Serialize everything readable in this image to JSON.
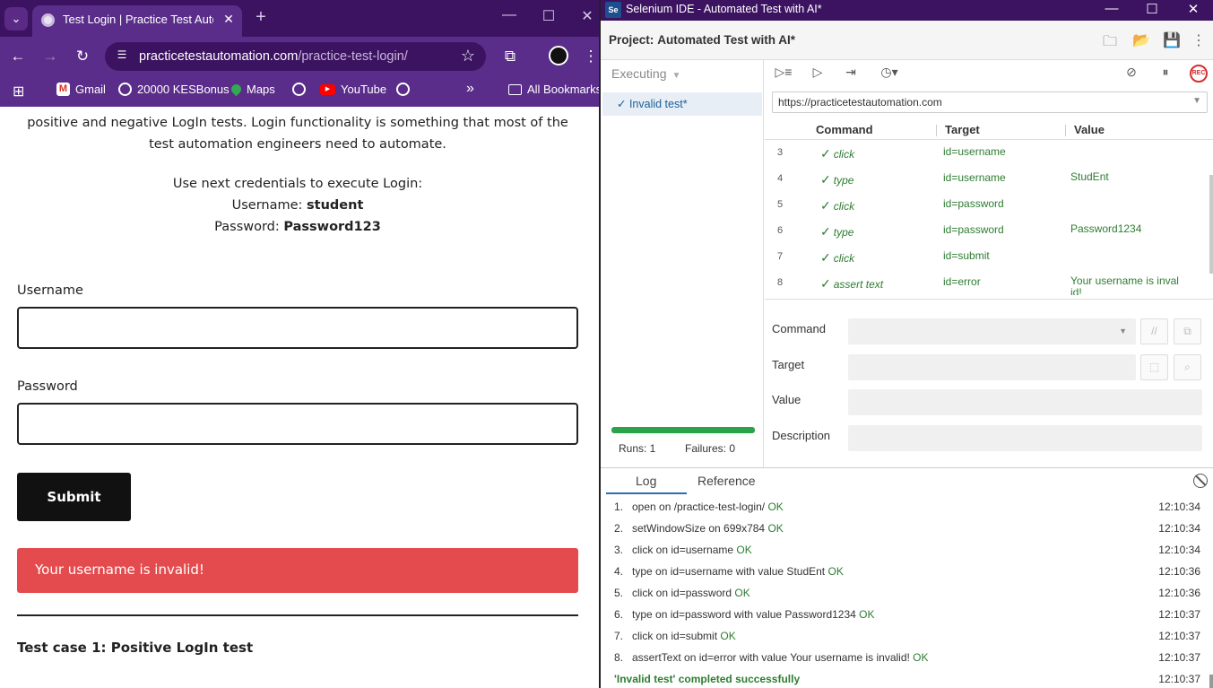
{
  "browser": {
    "tab": {
      "title": "Test Login | Practice Test Automation"
    },
    "url": {
      "host": "practicetestautomation.com",
      "path": "/practice-test-login/"
    },
    "bookmarks": [
      {
        "label": "Gmail",
        "icon": "gmail-icon"
      },
      {
        "label": "20000 KESBonus",
        "icon": "globe-icon"
      },
      {
        "label": "Maps",
        "icon": "maps-icon"
      },
      {
        "label": "",
        "icon": "globe-icon"
      },
      {
        "label": "YouTube",
        "icon": "youtube-icon"
      },
      {
        "label": "",
        "icon": "globe-icon"
      }
    ],
    "bookmarks_overflow": "»",
    "all_bookmarks": "All Bookmarks"
  },
  "page": {
    "intro_line1": "positive and negative LogIn tests. Login functionality is something that most of the",
    "intro_line2": "test automation engineers need to automate.",
    "creds_heading": "Use next credentials to execute Login:",
    "username_prefix": "Username: ",
    "username_value": "student",
    "password_prefix": "Password: ",
    "password_value": "Password123",
    "username_label": "Username",
    "password_label": "Password",
    "submit_label": "Submit",
    "error_message": "Your username is invalid!",
    "test_case_title": "Test case 1: Positive LogIn test"
  },
  "ide": {
    "window_title": "Selenium IDE - Automated Test with AI*",
    "logo_text": "Se",
    "project_label": "Project:",
    "project_name": "Automated Test with AI*",
    "executing_label": "Executing",
    "test_name": "✓ Invalid test*",
    "runs_label": "Runs: 1",
    "failures_label": "Failures: 0",
    "base_url": "https://practicetestautomation.com",
    "columns": {
      "command": "Command",
      "target": "Target",
      "value": "Value"
    },
    "commands": [
      {
        "num": "3",
        "command": "click",
        "target": "id=username",
        "value": ""
      },
      {
        "num": "4",
        "command": "type",
        "target": "id=username",
        "value": "StudEnt"
      },
      {
        "num": "5",
        "command": "click",
        "target": "id=password",
        "value": ""
      },
      {
        "num": "6",
        "command": "type",
        "target": "id=password",
        "value": "Password1234"
      },
      {
        "num": "7",
        "command": "click",
        "target": "id=submit",
        "value": ""
      },
      {
        "num": "8",
        "command": "assert text",
        "target": "id=error",
        "value": "Your username is inval id!"
      }
    ],
    "form": {
      "command_label": "Command",
      "target_label": "Target",
      "value_label": "Value",
      "description_label": "Description"
    },
    "log_tabs": {
      "log": "Log",
      "reference": "Reference"
    },
    "log": [
      {
        "num": "1.",
        "text": "open on /practice-test-login/",
        "status": "OK",
        "time": "12:10:34"
      },
      {
        "num": "2.",
        "text": "setWindowSize on 699x784",
        "status": "OK",
        "time": "12:10:34"
      },
      {
        "num": "3.",
        "text": "click on id=username",
        "status": "OK",
        "time": "12:10:34"
      },
      {
        "num": "4.",
        "text": "type on id=username with value StudEnt",
        "status": "OK",
        "time": "12:10:36"
      },
      {
        "num": "5.",
        "text": "click on id=password",
        "status": "OK",
        "time": "12:10:36"
      },
      {
        "num": "6.",
        "text": "type on id=password with value Password1234",
        "status": "OK",
        "time": "12:10:37"
      },
      {
        "num": "7.",
        "text": "click on id=submit",
        "status": "OK",
        "time": "12:10:37"
      },
      {
        "num": "8.",
        "text": "assertText on id=error with value Your username is invalid!",
        "status": "OK",
        "time": "12:10:37"
      }
    ],
    "log_final": {
      "text": "'Invalid test' completed successfully",
      "time": "12:10:37"
    }
  },
  "colors": {
    "chrome_frame": "#5b2d8a",
    "chrome_titlebar": "#3c1361",
    "error": "#e44b4e",
    "ok_green": "#2e7d32",
    "progress": "#2aa34a"
  }
}
